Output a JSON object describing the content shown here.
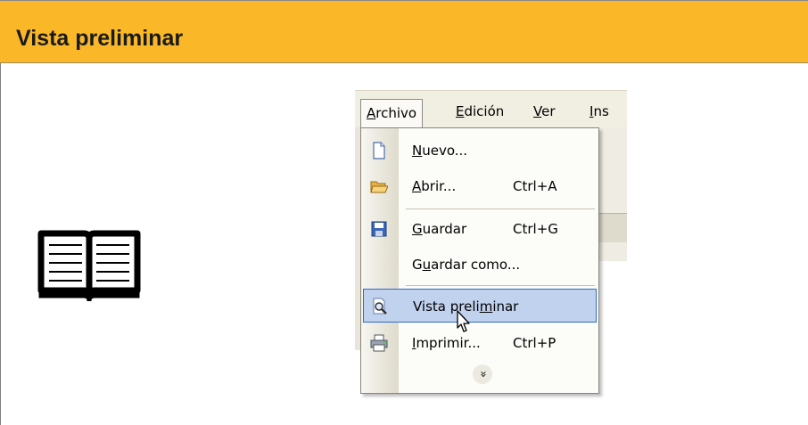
{
  "header": {
    "title": "Vista preliminar"
  },
  "icons": {
    "book": "open-book-icon",
    "cursor": "mouse-pointer-icon"
  },
  "colors": {
    "header_bg": "#fab828",
    "selection_bg": "#c1d2ee",
    "selection_border": "#316ac5"
  },
  "menubar": {
    "items": [
      {
        "label": "Archivo",
        "mnemonic": "A",
        "rest": "rchivo"
      },
      {
        "label": "Edición",
        "mnemonic": "E",
        "rest": "dición"
      },
      {
        "label": "Ver",
        "mnemonic": "V",
        "rest": "er"
      },
      {
        "label": "Ins",
        "mnemonic": "I",
        "rest": "ns"
      }
    ]
  },
  "menu": {
    "items": [
      {
        "pre": "",
        "mnemonic": "N",
        "post": "uevo...",
        "shortcut": "",
        "icon": "new-document-icon"
      },
      {
        "pre": "",
        "mnemonic": "A",
        "post": "brir...",
        "shortcut": "Ctrl+A",
        "icon": "open-folder-icon"
      },
      {
        "pre": "",
        "mnemonic": "G",
        "post": "uardar",
        "shortcut": "Ctrl+G",
        "icon": "save-disk-icon"
      },
      {
        "pre": "G",
        "mnemonic": "u",
        "post": "ardar como...",
        "shortcut": "",
        "icon": ""
      },
      {
        "pre": "Vista preli",
        "mnemonic": "m",
        "post": "inar",
        "shortcut": "",
        "icon": "print-preview-icon",
        "selected": true
      },
      {
        "pre": "",
        "mnemonic": "I",
        "post": "mprimir...",
        "shortcut": "Ctrl+P",
        "icon": "printer-icon"
      }
    ],
    "expand_label": "»"
  }
}
